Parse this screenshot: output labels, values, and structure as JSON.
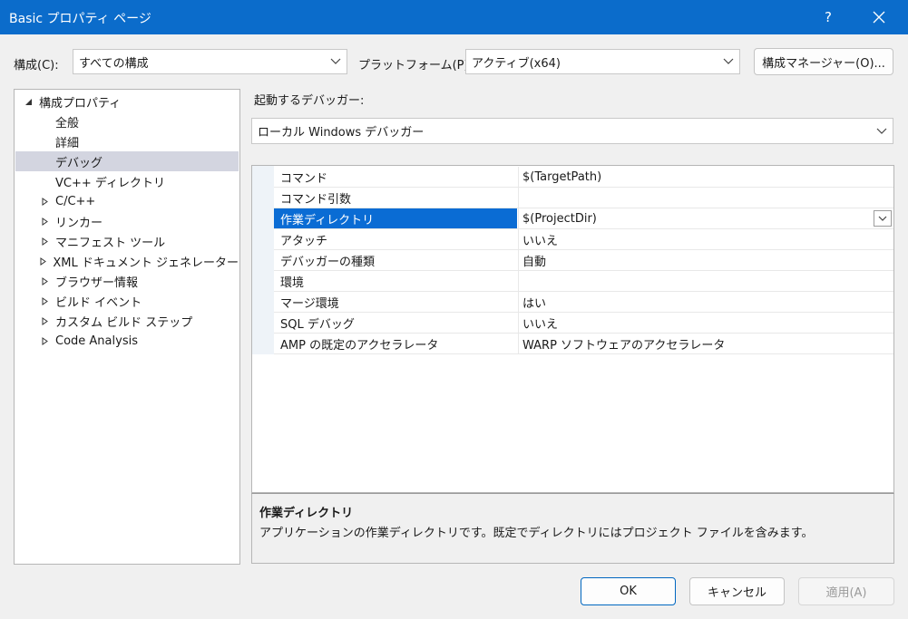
{
  "window": {
    "title": "Basic プロパティ ページ",
    "help_label": "?"
  },
  "config": {
    "label": "構成(C):",
    "value": "すべての構成",
    "platform_label": "プラットフォーム(P):",
    "platform_value": "アクティブ(x64)",
    "manager_button": "構成マネージャー(O)..."
  },
  "tree": {
    "root": "構成プロパティ",
    "items": [
      {
        "label": "全般",
        "expandable": false
      },
      {
        "label": "詳細",
        "expandable": false
      },
      {
        "label": "デバッグ",
        "expandable": false,
        "selected": true
      },
      {
        "label": "VC++ ディレクトリ",
        "expandable": false
      },
      {
        "label": "C/C++",
        "expandable": true
      },
      {
        "label": "リンカー",
        "expandable": true
      },
      {
        "label": "マニフェスト ツール",
        "expandable": true
      },
      {
        "label": "XML ドキュメント ジェネレーター",
        "expandable": true
      },
      {
        "label": "ブラウザー情報",
        "expandable": true
      },
      {
        "label": "ビルド イベント",
        "expandable": true
      },
      {
        "label": "カスタム ビルド ステップ",
        "expandable": true
      },
      {
        "label": "Code Analysis",
        "expandable": true
      }
    ]
  },
  "debugger": {
    "label": "起動するデバッガー:",
    "value": "ローカル Windows デバッガー"
  },
  "properties": [
    {
      "name": "コマンド",
      "value": "$(TargetPath)"
    },
    {
      "name": "コマンド引数",
      "value": ""
    },
    {
      "name": "作業ディレクトリ",
      "value": "$(ProjectDir)",
      "selected": true
    },
    {
      "name": "アタッチ",
      "value": "いいえ"
    },
    {
      "name": "デバッガーの種類",
      "value": "自動"
    },
    {
      "name": "環境",
      "value": ""
    },
    {
      "name": "マージ環境",
      "value": "はい"
    },
    {
      "name": "SQL デバッグ",
      "value": "いいえ"
    },
    {
      "name": "AMP の既定のアクセラレータ",
      "value": "WARP ソフトウェアのアクセラレータ"
    }
  ],
  "description": {
    "title": "作業ディレクトリ",
    "text": "アプリケーションの作業ディレクトリです。既定でディレクトリにはプロジェクト ファイルを含みます。"
  },
  "buttons": {
    "ok": "OK",
    "cancel": "キャンセル",
    "apply": "適用(A)"
  },
  "colors": {
    "titlebar": "#0b6ccb",
    "selection": "#0a6cd4",
    "tree_selection": "#d3d5e0"
  }
}
